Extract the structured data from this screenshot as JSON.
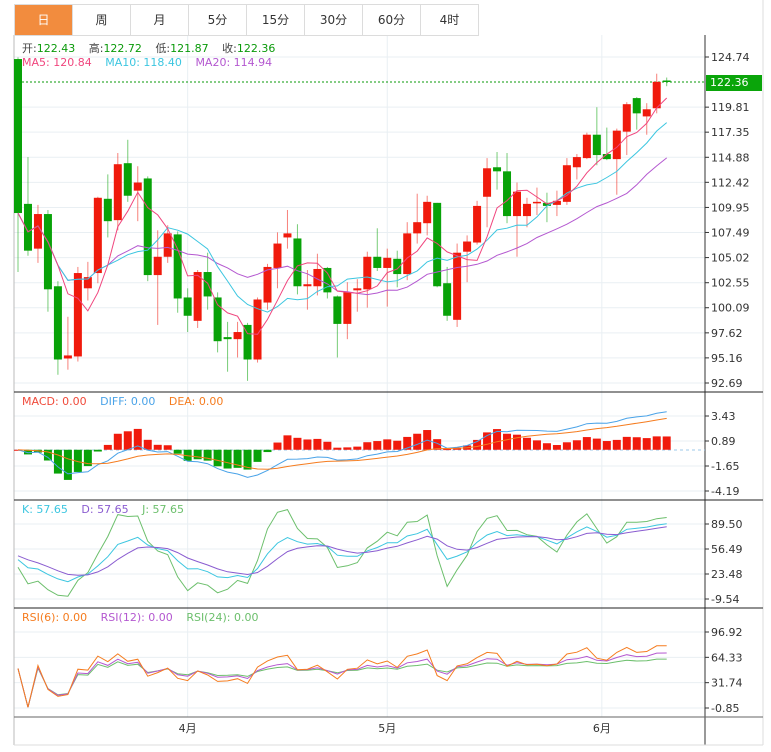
{
  "tabs": [
    {
      "label": "日",
      "active": true
    },
    {
      "label": "周"
    },
    {
      "label": "月"
    },
    {
      "label": "5分"
    },
    {
      "label": "15分"
    },
    {
      "label": "30分"
    },
    {
      "label": "60分"
    },
    {
      "label": "4时"
    }
  ],
  "ohlc_legend": {
    "open_label": "开:",
    "open": "122.43",
    "high_label": "高:",
    "high": "122.72",
    "low_label": "低:",
    "low": "121.87",
    "close_label": "收:",
    "close": "122.36"
  },
  "ma_legend": {
    "ma5": "MA5: 120.84",
    "ma10": "MA10: 118.40",
    "ma20": "MA20: 114.94"
  },
  "macd_legend": {
    "macd": "MACD: 0.00",
    "diff": "DIFF: 0.00",
    "dea": "DEA: 0.00"
  },
  "kdj_legend": {
    "k": "K: 57.65",
    "d": "D: 57.65",
    "j": "J: 57.65"
  },
  "rsi_legend": {
    "rsi6": "RSI(6): 0.00",
    "rsi12": "RSI(12): 0.00",
    "rsi24": "RSI(24): 0.00"
  },
  "current_price": "122.36",
  "colors": {
    "up": "#f01a0c",
    "down": "#08a208",
    "ma5": "#f0467e",
    "ma10": "#3cc6e0",
    "ma20": "#b458d0",
    "diff": "#4aa3e8",
    "dea": "#f57c1f",
    "k": "#3cc6e0",
    "d": "#8a5cd0",
    "j": "#6cbf6c",
    "rsi6": "#f57c1f",
    "rsi12": "#b458d0",
    "rsi24": "#6cbf6c",
    "accent": "#f28c3e"
  },
  "chart_data": {
    "type": "candlestick",
    "price_axis": {
      "ticks": [
        "124.74",
        "119.81",
        "117.35",
        "114.88",
        "112.42",
        "109.95",
        "107.49",
        "105.02",
        "102.55",
        "100.09",
        "97.62",
        "95.16",
        "92.69"
      ],
      "range": [
        92.69,
        124.74
      ]
    },
    "macd_axis": {
      "ticks": [
        "3.43",
        "0.89",
        "-1.65",
        "-4.19"
      ],
      "range": [
        -4.19,
        3.43
      ]
    },
    "kdj_axis": {
      "ticks": [
        "89.50",
        "56.49",
        "23.48",
        "-9.54"
      ],
      "range": [
        -9.54,
        89.5
      ]
    },
    "rsi_axis": {
      "ticks": [
        "96.92",
        "64.33",
        "31.74",
        "-0.85"
      ],
      "range": [
        -0.85,
        96.92
      ]
    },
    "x_labels": [
      {
        "label": "4月",
        "index": 17
      },
      {
        "label": "5月",
        "index": 37
      },
      {
        "label": "6月",
        "index": 58.5
      }
    ],
    "candles": [
      [
        124.54,
        124.7,
        103.6,
        109.4
      ],
      [
        110.3,
        114.9,
        105.2,
        105.7
      ],
      [
        105.9,
        110.2,
        104.5,
        109.3
      ],
      [
        109.3,
        109.7,
        99.7,
        101.9
      ],
      [
        102.2,
        102.7,
        93.5,
        95.0
      ],
      [
        95.1,
        99.2,
        94.0,
        95.4
      ],
      [
        95.3,
        104.1,
        94.8,
        103.5
      ],
      [
        102.0,
        104.6,
        100.8,
        103.1
      ],
      [
        103.5,
        111.0,
        102.5,
        110.9
      ],
      [
        110.8,
        113.2,
        107.0,
        108.6
      ],
      [
        108.7,
        115.3,
        107.7,
        114.2
      ],
      [
        114.3,
        116.6,
        110.5,
        111.1
      ],
      [
        111.6,
        114.0,
        108.6,
        112.4
      ],
      [
        112.8,
        113.0,
        102.7,
        103.3
      ],
      [
        103.3,
        107.7,
        98.4,
        105.1
      ],
      [
        105.1,
        108.2,
        104.5,
        107.4
      ],
      [
        107.3,
        107.6,
        99.6,
        101.0
      ],
      [
        101.1,
        102.0,
        97.7,
        99.3
      ],
      [
        98.8,
        103.8,
        98.1,
        103.6
      ],
      [
        103.6,
        105.5,
        99.9,
        101.2
      ],
      [
        101.1,
        101.6,
        95.7,
        96.8
      ],
      [
        97.2,
        98.7,
        93.8,
        97.0
      ],
      [
        97.0,
        98.7,
        95.2,
        97.7
      ],
      [
        98.4,
        98.6,
        92.9,
        95.0
      ],
      [
        95.0,
        101.1,
        94.7,
        100.9
      ],
      [
        100.6,
        104.4,
        99.9,
        104.1
      ],
      [
        104.0,
        107.5,
        102.0,
        106.4
      ],
      [
        107.0,
        109.7,
        105.9,
        107.4
      ],
      [
        106.9,
        108.3,
        101.4,
        102.2
      ],
      [
        102.2,
        103.8,
        99.9,
        102.4
      ],
      [
        102.2,
        105.4,
        101.3,
        103.9
      ],
      [
        104.0,
        104.1,
        101.0,
        101.6
      ],
      [
        101.2,
        101.3,
        95.2,
        98.5
      ],
      [
        98.5,
        102.6,
        97.0,
        101.6
      ],
      [
        101.8,
        102.9,
        99.7,
        102.0
      ],
      [
        101.9,
        105.6,
        100.1,
        105.1
      ],
      [
        105.1,
        107.9,
        103.7,
        104.0
      ],
      [
        104.0,
        105.9,
        100.2,
        105.0
      ],
      [
        104.9,
        105.7,
        102.1,
        103.4
      ],
      [
        103.4,
        108.5,
        102.8,
        107.4
      ],
      [
        107.4,
        111.3,
        106.4,
        108.5
      ],
      [
        108.4,
        111.1,
        107.2,
        110.5
      ],
      [
        110.4,
        110.4,
        102.1,
        102.2
      ],
      [
        102.5,
        104.1,
        98.8,
        99.3
      ],
      [
        98.9,
        106.4,
        98.2,
        105.5
      ],
      [
        105.6,
        107.2,
        102.6,
        106.6
      ],
      [
        106.5,
        110.6,
        106.3,
        110.1
      ],
      [
        111.0,
        114.8,
        108.0,
        113.8
      ],
      [
        113.9,
        115.4,
        111.7,
        113.5
      ],
      [
        113.5,
        115.3,
        108.4,
        109.1
      ],
      [
        109.1,
        112.4,
        105.1,
        111.5
      ],
      [
        109.1,
        110.9,
        108.0,
        110.3
      ],
      [
        110.4,
        111.9,
        109.2,
        110.5
      ],
      [
        110.4,
        111.4,
        108.5,
        110.1
      ],
      [
        110.2,
        111.6,
        109.1,
        110.6
      ],
      [
        110.5,
        114.8,
        110.2,
        114.1
      ],
      [
        113.9,
        115.2,
        112.7,
        114.9
      ],
      [
        114.8,
        117.3,
        114.7,
        117.1
      ],
      [
        117.1,
        119.8,
        114.1,
        115.1
      ],
      [
        115.2,
        117.8,
        114.6,
        114.7
      ],
      [
        114.7,
        117.7,
        111.2,
        117.5
      ],
      [
        117.4,
        120.3,
        115.1,
        120.1
      ],
      [
        120.7,
        120.8,
        117.6,
        119.2
      ],
      [
        118.9,
        120.2,
        117.1,
        119.6
      ],
      [
        119.7,
        123.1,
        119.2,
        122.3
      ],
      [
        122.43,
        122.72,
        121.87,
        122.36
      ]
    ],
    "candle_format": [
      "open",
      "high",
      "low",
      "close"
    ],
    "indicators": [
      "MA5",
      "MA10",
      "MA20",
      "MACD(12,26,9)",
      "KDJ(9,3,3)",
      "RSI(6,12,24)"
    ]
  }
}
